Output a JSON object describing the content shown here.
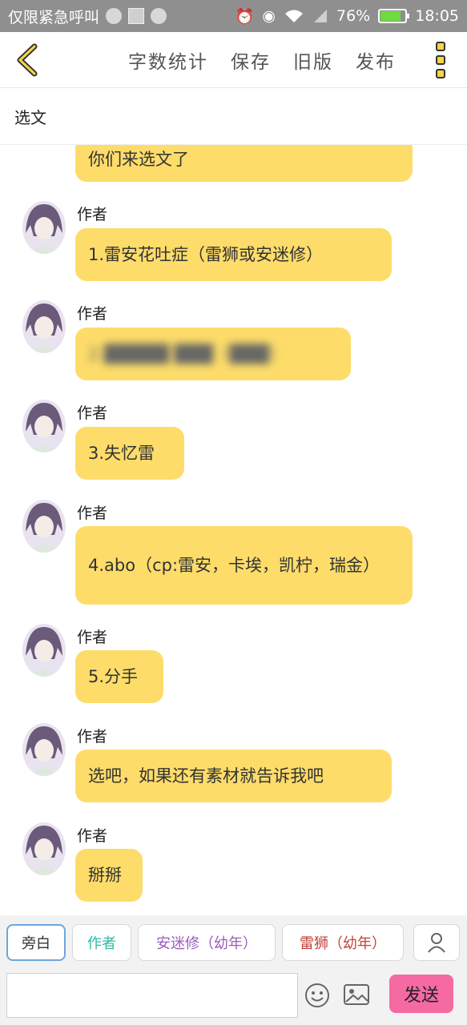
{
  "status_bar": {
    "carrier": "仅限紧急呼叫",
    "battery": "76%",
    "time": "18:05"
  },
  "toolbar": {
    "word_count": "字数统计",
    "save": "保存",
    "old_version": "旧版",
    "publish": "发布"
  },
  "title": "选文",
  "messages": [
    {
      "name": "",
      "text": "你们来选文了"
    },
    {
      "name": "作者",
      "text": "1.雷安花吐症（雷狮或安迷修）"
    },
    {
      "name": "作者",
      "text": "2.█████ ███（███）",
      "blurred": true
    },
    {
      "name": "作者",
      "text": "3.失忆雷"
    },
    {
      "name": "作者",
      "text": "4.abo（cp:雷安，卡埃，凯柠，瑞金）"
    },
    {
      "name": "作者",
      "text": "5.分手"
    },
    {
      "name": "作者",
      "text": "选吧，如果还有素材就告诉我吧"
    },
    {
      "name": "作者",
      "text": "掰掰"
    }
  ],
  "roles": [
    {
      "label": "旁白",
      "color": "#333333",
      "active": true
    },
    {
      "label": "作者",
      "color": "#2fb8a4",
      "active": false
    },
    {
      "label": "安迷修（幼年）",
      "color": "#9b5db8",
      "active": false
    },
    {
      "label": "雷狮（幼年）",
      "color": "#c2413a",
      "active": false
    }
  ],
  "input": {
    "value": "",
    "send_label": "发送"
  },
  "icons": {
    "back": "chevron-left-icon",
    "more": "more-vertical-icon",
    "add_role": "person-icon",
    "emoji": "smile-icon",
    "image": "image-icon"
  },
  "colors": {
    "bubble": "#fddc6a",
    "send": "#f56aa2",
    "status_bar": "#8f8f8f"
  }
}
